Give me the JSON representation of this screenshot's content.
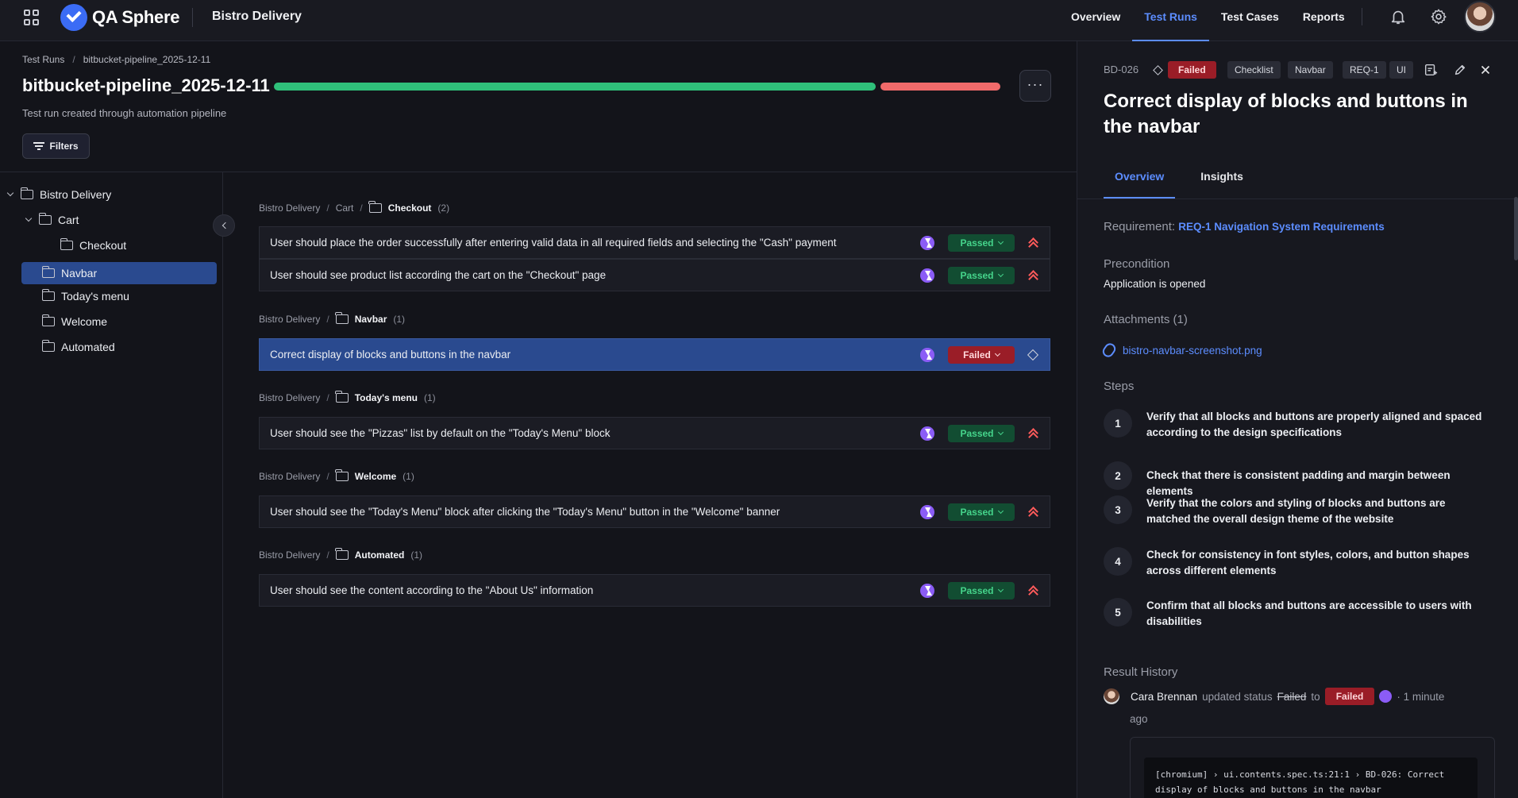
{
  "topnav": {
    "logo_text": "QA Sphere",
    "project": "Bistro Delivery",
    "links": [
      "Overview",
      "Test Runs",
      "Test Cases",
      "Reports"
    ],
    "active_link": "Test Runs"
  },
  "header": {
    "breadcrumb": [
      "Test Runs",
      "bitbucket-pipeline_2025-12-11"
    ],
    "title": "bitbucket-pipeline_2025-12-11",
    "description": "Test run created through automation pipeline",
    "filters_label": "Filters",
    "more_label": "···",
    "progress": {
      "passed": 5,
      "failed": 1
    }
  },
  "colors": {
    "accent": "#5c8dff",
    "passed": "#2fc07a",
    "failed": "#f06a6a",
    "automation": "#8b5cf6"
  },
  "tree": [
    {
      "label": "Bistro Delivery",
      "expanded": true
    },
    {
      "label": "Cart",
      "expanded": true
    },
    {
      "label": "Checkout"
    },
    {
      "label": "Navbar",
      "selected": true
    },
    {
      "label": "Today's menu"
    },
    {
      "label": "Welcome"
    },
    {
      "label": "Automated"
    }
  ],
  "groups": [
    {
      "path": [
        "Bistro Delivery",
        "Cart"
      ],
      "folder": "Checkout",
      "count": "(2)",
      "cases": [
        {
          "title": "User should place the order successfully after entering valid data in all required fields and selecting the \"Cash\" payment",
          "status": "Passed",
          "priority": "high"
        },
        {
          "title": "User should see product list according the cart on the \"Checkout\" page",
          "status": "Passed",
          "priority": "high"
        }
      ]
    },
    {
      "path": [
        "Bistro Delivery"
      ],
      "folder": "Navbar",
      "count": "(1)",
      "cases": [
        {
          "title": "Correct display of blocks and buttons in the navbar",
          "status": "Failed",
          "priority": "none",
          "selected": true
        }
      ]
    },
    {
      "path": [
        "Bistro Delivery"
      ],
      "folder": "Today's menu",
      "count": "(1)",
      "cases": [
        {
          "title": "User should see the \"Pizzas\" list by default on the \"Today's Menu\" block",
          "status": "Passed",
          "priority": "high"
        }
      ]
    },
    {
      "path": [
        "Bistro Delivery"
      ],
      "folder": "Welcome",
      "count": "(1)",
      "cases": [
        {
          "title": "User should see the \"Today's Menu\" block after clicking the \"Today's Menu\" button in the \"Welcome\" banner",
          "status": "Passed",
          "priority": "high"
        }
      ]
    },
    {
      "path": [
        "Bistro Delivery"
      ],
      "folder": "Automated",
      "count": "(1)",
      "cases": [
        {
          "title": "User should see the content according to the \"About Us\" information",
          "status": "Passed",
          "priority": "high"
        }
      ]
    }
  ],
  "panel": {
    "case_id": "BD-026",
    "status": "Failed",
    "tags": [
      "Checklist",
      "Navbar",
      "REQ-1",
      "UI"
    ],
    "title": "Correct display of blocks and buttons in the navbar",
    "tabs": [
      "Overview",
      "Insights"
    ],
    "active_tab": "Overview",
    "requirement_label": "Requirement:",
    "requirement_link": "REQ-1 Navigation System Requirements",
    "precondition_label": "Precondition",
    "precondition": "Application is opened",
    "attachments_label": "Attachments (1)",
    "attachment_file": "bistro-navbar-screenshot.png",
    "steps_label": "Steps",
    "steps": [
      {
        "num": "1",
        "text": "Verify that all blocks and buttons are properly aligned and spaced according to the design specifications"
      },
      {
        "num": "2",
        "text": "Check that there is consistent padding and margin between elements"
      },
      {
        "num": "3",
        "text": "Verify that the colors and styling of blocks and buttons are matched the overall design theme of the website"
      },
      {
        "num": "4",
        "text": "Check for consistency in font styles, colors, and button shapes across different elements"
      },
      {
        "num": "5",
        "text": "Confirm that all blocks and buttons are accessible to users with disabilities"
      }
    ],
    "history_label": "Result History",
    "history": {
      "user": "Cara Brennan",
      "action": "updated status",
      "from": "Failed",
      "to_word": "to",
      "to": "Failed",
      "time_1": "· 1 minute",
      "time_2": "ago",
      "log_line_1": "[chromium] › ui.contents.spec.ts:21:1 › BD-026: Correct",
      "log_line_2": "display of blocks and buttons in the navbar"
    }
  }
}
